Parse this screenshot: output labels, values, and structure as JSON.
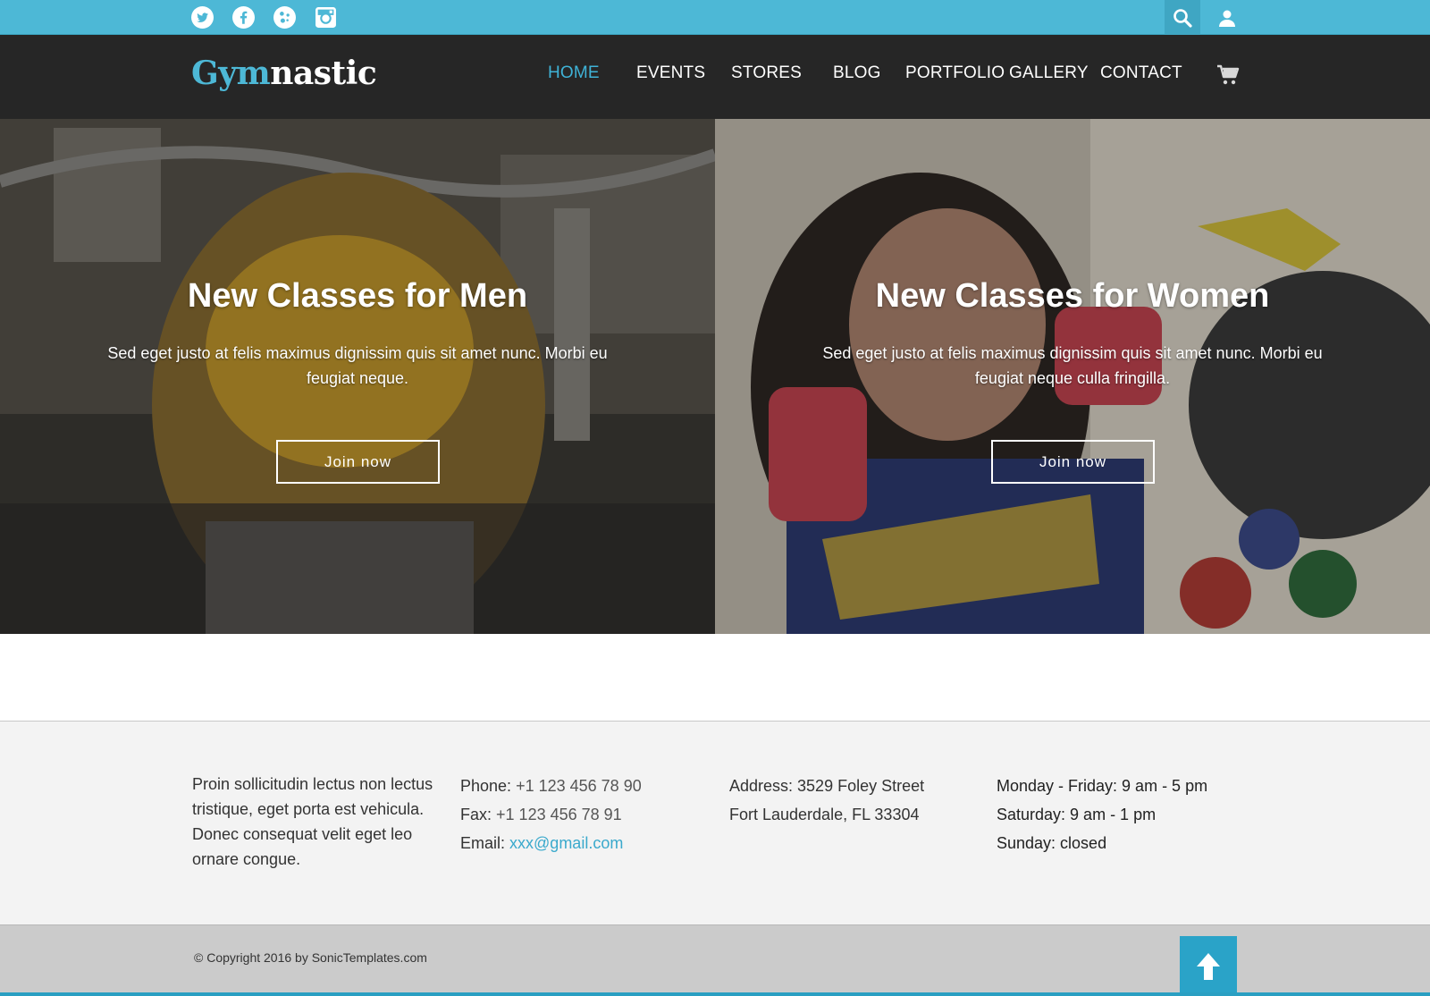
{
  "topbar": {
    "social_icons": [
      "twitter-icon",
      "facebook-icon",
      "google-plus-icon",
      "instagram-icon"
    ],
    "tools": [
      "search-icon",
      "user-icon"
    ],
    "color": "#4db8d6"
  },
  "header": {
    "logo_part1": "Gym",
    "logo_part2": "nastic",
    "nav": {
      "home": "HOME",
      "events": "EVENTS",
      "stores": "STORES",
      "blog": "BLOG",
      "portfolio": "PORTFOLIO",
      "gallery": "GALLERY",
      "contact": "CONTACT"
    },
    "active_item": "HOME",
    "cart_icon": "cart-icon"
  },
  "hero": {
    "men": {
      "title": "New Classes for Men",
      "text": "Sed eget justo at felis maximus dignissim quis sit amet nunc. Morbi eu feugiat neque.",
      "button": "Join now"
    },
    "women": {
      "title": "New Classes for Women",
      "text": "Sed eget justo at felis maximus dignissim quis sit amet nunc. Morbi eu feugiat neque culla fringilla.",
      "button": "Join now"
    }
  },
  "footer": {
    "about": "Proin sollicitudin lectus non lectus tristique, eget porta est vehicula. Donec consequat velit eget leo ornare congue.",
    "phone_label": "Phone:",
    "phone": "+1 123 456 78 90",
    "fax_label": "Fax:",
    "fax": "+1 123 456 78 91",
    "email_label": "Email:",
    "email": "xxx@gmail.com",
    "address_line1": "Address: 3529 Foley Street",
    "address_line2": "Fort Lauderdale, FL 33304",
    "hours_weekdays": "Monday - Friday: 9 am - 5 pm",
    "hours_saturday": "Saturday: 9 am - 1 pm",
    "hours_sunday": "Sunday: closed",
    "copyright": "© Copyright 2016 by SonicTemplates.com",
    "to_top_icon": "arrow-up-icon"
  },
  "colors": {
    "accent": "#4db8d6",
    "nav_bg": "#262626",
    "link": "#3aa9cc"
  }
}
